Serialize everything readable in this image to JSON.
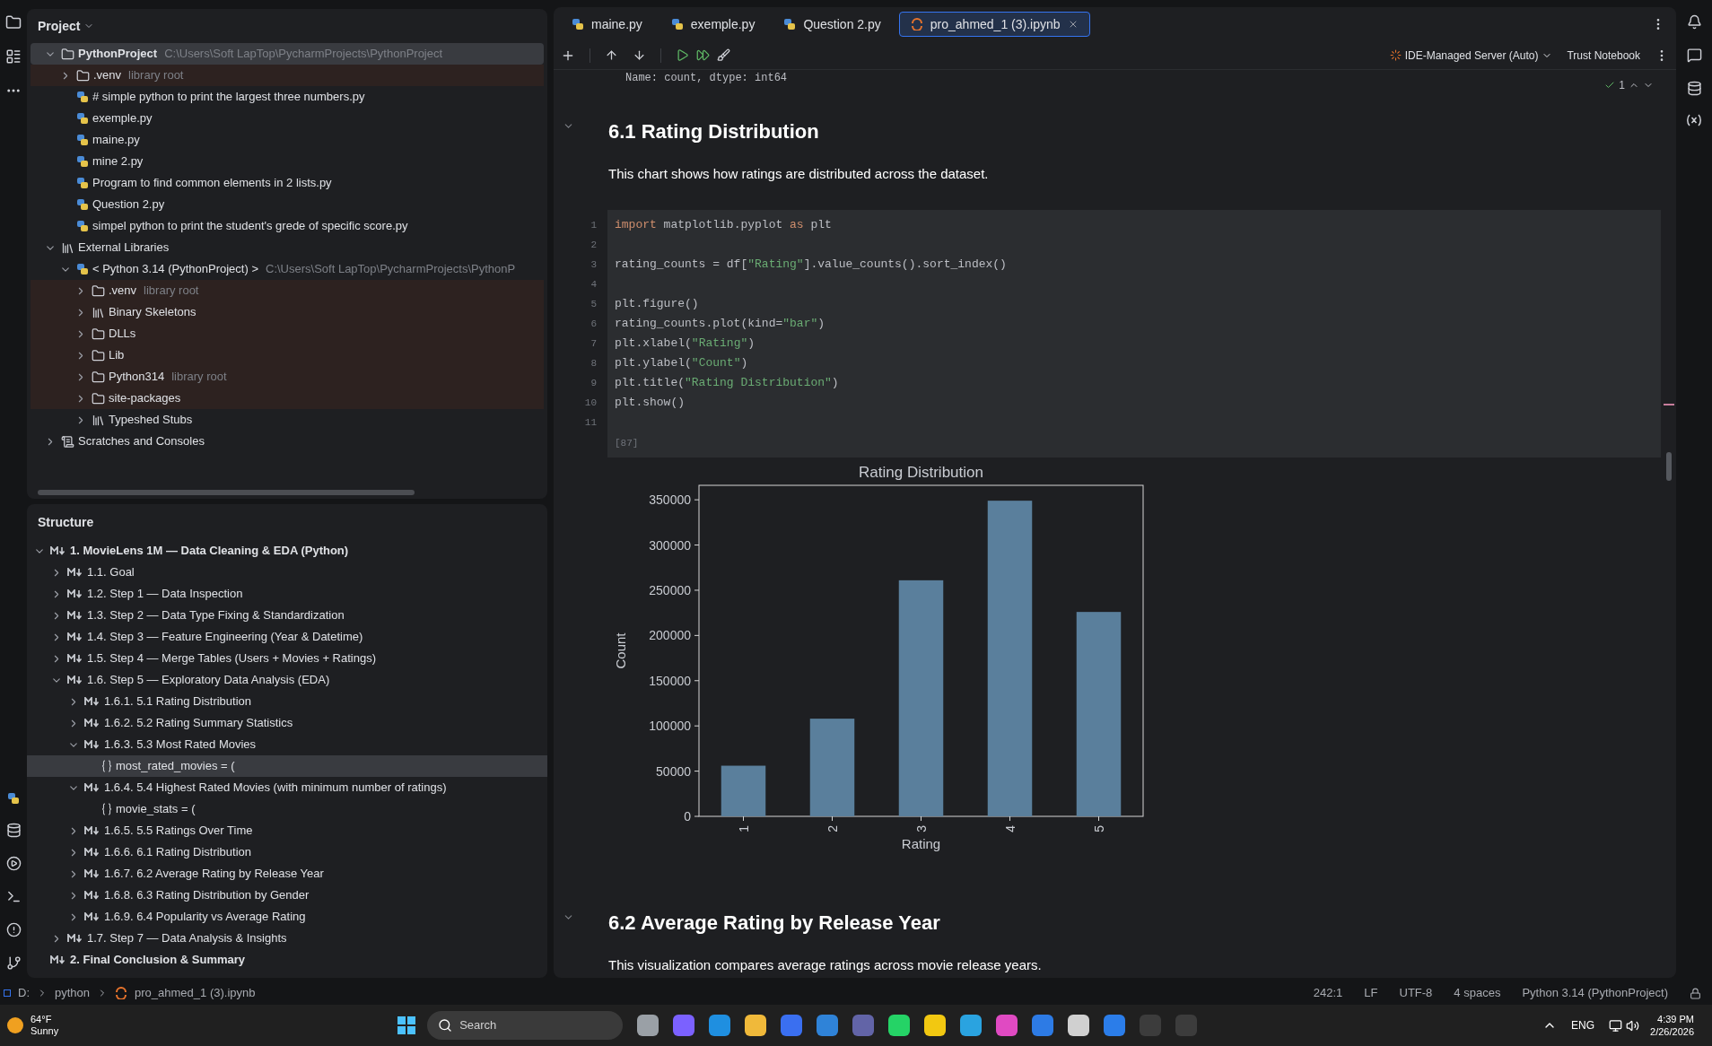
{
  "project": {
    "title": "Project",
    "tree": [
      {
        "label": "PythonProject",
        "hint": "C:\\Users\\Soft LapTop\\PycharmProjects\\PythonProject",
        "kind": "folder",
        "expanded": true,
        "selected": true,
        "tinted": false,
        "children": [
          {
            "label": ".venv",
            "hint": "library root",
            "kind": "folder",
            "expanded": false,
            "selected": false,
            "tinted": true
          },
          {
            "label": "# simple python to print the largest three numbers.py",
            "kind": "python",
            "selected": false,
            "tinted": false
          },
          {
            "label": "exemple.py",
            "kind": "python",
            "selected": false,
            "tinted": false
          },
          {
            "label": "maine.py",
            "kind": "python",
            "selected": false,
            "tinted": false
          },
          {
            "label": "mine 2.py",
            "kind": "python",
            "selected": false,
            "tinted": false
          },
          {
            "label": "Program to find common elements in 2 lists.py",
            "kind": "python",
            "selected": false,
            "tinted": false
          },
          {
            "label": "Question 2.py",
            "kind": "python",
            "selected": false,
            "tinted": false
          },
          {
            "label": "simpel python to print the student's grede of specific score.py",
            "kind": "python",
            "selected": false,
            "tinted": false
          }
        ]
      },
      {
        "label": "External Libraries",
        "kind": "library",
        "expanded": true,
        "selected": false,
        "tinted": false,
        "children": [
          {
            "label": "< Python 3.14 (PythonProject) >",
            "hint": "C:\\Users\\Soft LapTop\\PycharmProjects\\PythonP",
            "kind": "python",
            "expanded": true,
            "selected": false,
            "tinted": false,
            "children": [
              {
                "label": ".venv",
                "hint": "library root",
                "kind": "folder",
                "expanded": false,
                "selected": false,
                "tinted": true
              },
              {
                "label": "Binary Skeletons",
                "kind": "library",
                "expanded": false,
                "selected": false,
                "tinted": true
              },
              {
                "label": "DLLs",
                "kind": "folder",
                "expanded": false,
                "selected": false,
                "tinted": true
              },
              {
                "label": "Lib",
                "kind": "folder",
                "expanded": false,
                "selected": false,
                "tinted": true
              },
              {
                "label": "Python314",
                "hint": "library root",
                "kind": "folder",
                "expanded": false,
                "selected": false,
                "tinted": true
              },
              {
                "label": "site-packages",
                "kind": "folder",
                "expanded": false,
                "selected": false,
                "tinted": true
              },
              {
                "label": "Typeshed Stubs",
                "kind": "library",
                "expanded": false,
                "selected": false,
                "tinted": false
              }
            ]
          }
        ]
      },
      {
        "label": "Scratches and Consoles",
        "kind": "scratch",
        "expanded": false,
        "selected": false,
        "tinted": false
      }
    ]
  },
  "structure": {
    "title": "Structure",
    "tree": [
      {
        "label": "1. MovieLens 1M — Data Cleaning & EDA (Python)",
        "kind": "markdown",
        "expanded": true,
        "selected": false,
        "children": [
          {
            "label": "1.1. Goal",
            "kind": "markdown",
            "expanded": false,
            "selected": false
          },
          {
            "label": "1.2. Step 1 — Data Inspection",
            "kind": "markdown",
            "expanded": false,
            "selected": false
          },
          {
            "label": "1.3. Step 2 — Data Type Fixing & Standardization",
            "kind": "markdown",
            "expanded": false,
            "selected": false
          },
          {
            "label": "1.4. Step 3 — Feature Engineering (Year & Datetime)",
            "kind": "markdown",
            "expanded": false,
            "selected": false
          },
          {
            "label": "1.5. Step 4 — Merge Tables (Users + Movies + Ratings)",
            "kind": "markdown",
            "expanded": false,
            "selected": false
          },
          {
            "label": "1.6. Step 5 — Exploratory Data Analysis (EDA)",
            "kind": "markdown",
            "expanded": true,
            "selected": false,
            "children": [
              {
                "label": "1.6.1. 5.1 Rating Distribution",
                "kind": "markdown",
                "expanded": false,
                "selected": false
              },
              {
                "label": "1.6.2. 5.2 Rating Summary Statistics",
                "kind": "markdown",
                "expanded": false,
                "selected": false
              },
              {
                "label": "1.6.3. 5.3 Most Rated Movies",
                "kind": "markdown",
                "expanded": true,
                "selected": false,
                "children": [
                  {
                    "label": "most_rated_movies = (",
                    "kind": "variable",
                    "selected": true
                  }
                ]
              },
              {
                "label": "1.6.4. 5.4 Highest Rated Movies (with minimum number of ratings)",
                "kind": "markdown",
                "expanded": true,
                "selected": false,
                "children": [
                  {
                    "label": "movie_stats = (",
                    "kind": "variable",
                    "selected": false
                  }
                ]
              },
              {
                "label": "1.6.5. 5.5 Ratings Over Time",
                "kind": "markdown",
                "expanded": false,
                "selected": false
              },
              {
                "label": "1.6.6. 6.1 Rating Distribution",
                "kind": "markdown",
                "expanded": false,
                "selected": false
              },
              {
                "label": "1.6.7. 6.2 Average Rating by Release Year",
                "kind": "markdown",
                "expanded": false,
                "selected": false
              },
              {
                "label": "1.6.8. 6.3 Rating Distribution by Gender",
                "kind": "markdown",
                "expanded": false,
                "selected": false
              },
              {
                "label": "1.6.9. 6.4 Popularity vs Average Rating",
                "kind": "markdown",
                "expanded": false,
                "selected": false
              }
            ]
          },
          {
            "label": "1.7. Step 7 — Data Analysis & Insights",
            "kind": "markdown",
            "expanded": false,
            "selected": false
          }
        ]
      },
      {
        "label": "2. Final Conclusion & Summary",
        "kind": "markdown",
        "selected": false
      }
    ]
  },
  "tabs": [
    {
      "label": "maine.py",
      "kind": "python",
      "selected": false
    },
    {
      "label": "exemple.py",
      "kind": "python",
      "selected": false
    },
    {
      "label": "Question 2.py",
      "kind": "python",
      "selected": false
    },
    {
      "label": "pro_ahmed_1 (3).ipynb",
      "kind": "notebook",
      "selected": true
    }
  ],
  "toolbar": {
    "server": "IDE-Managed Server (Auto)",
    "trust": "Trust Notebook"
  },
  "notebook": {
    "output_tail": "Name: count, dtype: int64",
    "inspection_count": "1",
    "cells": [
      {
        "kind": "markdown",
        "heading": "6.1 Rating Distribution",
        "text": "This chart shows how ratings are distributed across the dataset."
      },
      {
        "kind": "code",
        "execution_count": "[87]",
        "lines": [
          {
            "number": "1",
            "segments": [
              {
                "text": "import",
                "kind": "keyword"
              },
              {
                "text": " matplotlib.pyplot ",
                "kind": "plain"
              },
              {
                "text": "as",
                "kind": "keyword"
              },
              {
                "text": " plt",
                "kind": "plain"
              }
            ]
          },
          {
            "number": "2"
          },
          {
            "number": "3",
            "segments": [
              {
                "text": "rating_counts = df[",
                "kind": "plain"
              },
              {
                "text": "\"Rating\"",
                "kind": "string"
              },
              {
                "text": "].value_counts().sort_index()",
                "kind": "plain"
              }
            ]
          },
          {
            "number": "4"
          },
          {
            "number": "5",
            "segments": [
              {
                "text": "plt.figure()",
                "kind": "plain"
              }
            ]
          },
          {
            "number": "6",
            "segments": [
              {
                "text": "rating_counts.plot(kind=",
                "kind": "plain"
              },
              {
                "text": "\"bar\"",
                "kind": "string"
              },
              {
                "text": ")",
                "kind": "plain"
              }
            ]
          },
          {
            "number": "7",
            "segments": [
              {
                "text": "plt.xlabel(",
                "kind": "plain"
              },
              {
                "text": "\"Rating\"",
                "kind": "string"
              },
              {
                "text": ")",
                "kind": "plain"
              }
            ]
          },
          {
            "number": "8",
            "segments": [
              {
                "text": "plt.ylabel(",
                "kind": "plain"
              },
              {
                "text": "\"Count\"",
                "kind": "string"
              },
              {
                "text": ")",
                "kind": "plain"
              }
            ]
          },
          {
            "number": "9",
            "segments": [
              {
                "text": "plt.title(",
                "kind": "plain"
              },
              {
                "text": "\"Rating Distribution\"",
                "kind": "string"
              },
              {
                "text": ")",
                "kind": "plain"
              }
            ]
          },
          {
            "number": "10",
            "segments": [
              {
                "text": "plt.show()",
                "kind": "plain"
              }
            ]
          },
          {
            "number": "11"
          }
        ],
        "chart_data": {
          "type": "bar",
          "title": "Rating Distribution",
          "xlabel": "Rating",
          "ylabel": "Count",
          "categories": [
            "1",
            "2",
            "3",
            "4",
            "5"
          ],
          "values": [
            56000,
            108000,
            261000,
            349000,
            226000
          ],
          "ylim": [
            0,
            366000
          ],
          "yticks": [
            0,
            50000,
            100000,
            150000,
            200000,
            250000,
            300000,
            350000
          ]
        }
      },
      {
        "kind": "markdown",
        "heading": "6.2 Average Rating by Release Year",
        "text": "This visualization compares average ratings across movie release years."
      }
    ]
  },
  "status_bar": {
    "breadcrumbs": [
      "D:",
      "python",
      "pro_ahmed_1 (3).ipynb"
    ],
    "items": [
      "242:1",
      "LF",
      "UTF-8",
      "4 spaces",
      "Python 3.14 (PythonProject)"
    ]
  },
  "taskbar": {
    "temperature": "64°F",
    "weather": "Sunny",
    "search": "Search",
    "language": "ENG",
    "time": "4:39 PM",
    "date": "2/26/2026"
  }
}
